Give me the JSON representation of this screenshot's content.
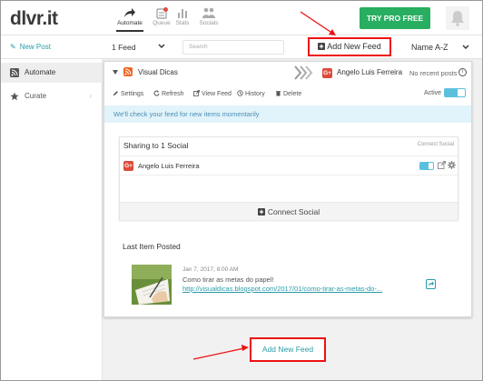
{
  "app": {
    "logo": "dlvr.it"
  },
  "nav": {
    "tabs": [
      {
        "label": "Automate",
        "active": true,
        "icon": "share-arrow-icon"
      },
      {
        "label": "Queue",
        "active": false,
        "icon": "queue-icon",
        "has_notification": true
      },
      {
        "label": "Stats",
        "active": false,
        "icon": "stats-icon"
      },
      {
        "label": "Socials",
        "active": false,
        "icon": "socials-icon"
      }
    ]
  },
  "header": {
    "try_pro": "TRY PRO FREE",
    "bell_icon": "bell-icon",
    "accent": "#27ae60"
  },
  "toolbar": {
    "new_post": "New Post",
    "feed_select": "1 Feed",
    "search_placeholder": "Search",
    "add_new_feed": "Add New Feed",
    "sort": "Name A-Z"
  },
  "sidebar": {
    "items": [
      {
        "label": "Automate",
        "icon": "rss-icon",
        "active": true
      },
      {
        "label": "Curate",
        "icon": "star-icon",
        "active": false
      }
    ]
  },
  "feed": {
    "name": "Visual Dicas",
    "user": "Angelo Luis Ferreira",
    "status": "No recent posts",
    "actions": [
      "Settings",
      "Refresh",
      "View Feed",
      "History",
      "Delete"
    ],
    "active_label": "Active",
    "info_message": "We'll check your feed for new items momentarily"
  },
  "sharing": {
    "title": "Sharing to 1 Social",
    "connect_small": "Connect Social",
    "accounts": [
      {
        "name": "Angelo Luis Ferreira",
        "network": "G+"
      }
    ],
    "connect_button": "Connect Social"
  },
  "last_item": {
    "heading": "Last Item Posted",
    "date": "Jan 7, 2017, 8:00 AM",
    "title": "Como tirar as metas do papel!",
    "link": "http://visualdicas.blogspot.com/2017/01/como-tirar-as-metas-do-..."
  },
  "bottom": {
    "add_new_feed": "Add New Feed"
  },
  "colors": {
    "highlight_border": "#e11111",
    "link": "#2a9ba8",
    "info_bg": "#e1f3fb",
    "rss": "#f26522",
    "gplus": "#dd4b39"
  }
}
